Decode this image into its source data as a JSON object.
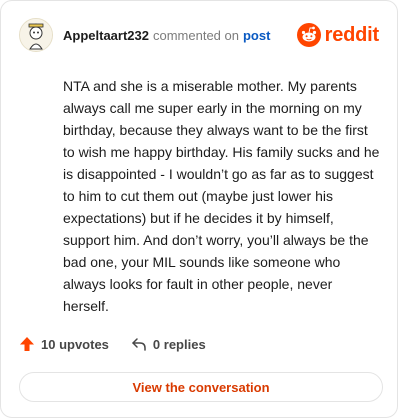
{
  "comment": {
    "username": "Appeltaart232",
    "action_text": "commented on",
    "post_link_label": "post",
    "body": "NTA and she is a miserable mother. My parents always call me super early in the morning on my birthday, because they always want to be the first to wish me happy birthday. His family sucks and he is disappointed - I wouldn’t go as far as to suggest to him to cut them out (maybe just lower his expectations) but if he decides it by himself, support him. And don’t worry, you’ll always be the bad one, your MIL sounds like someone who always looks for fault in other people, never herself.",
    "upvotes_label": "10 upvotes",
    "replies_label": "0 replies"
  },
  "brand": {
    "wordmark": "reddit",
    "color": "#ff4500"
  },
  "footer": {
    "cta_label": "View the conversation"
  },
  "icons": {
    "avatar": "snoo-avatar-icon",
    "logo": "reddit-logo-icon",
    "upvote": "upvote-arrow-icon",
    "reply": "reply-arrow-icon"
  },
  "colors": {
    "accent": "#ff4500",
    "link": "#0a5ac2",
    "cta_text": "#d93a00"
  }
}
